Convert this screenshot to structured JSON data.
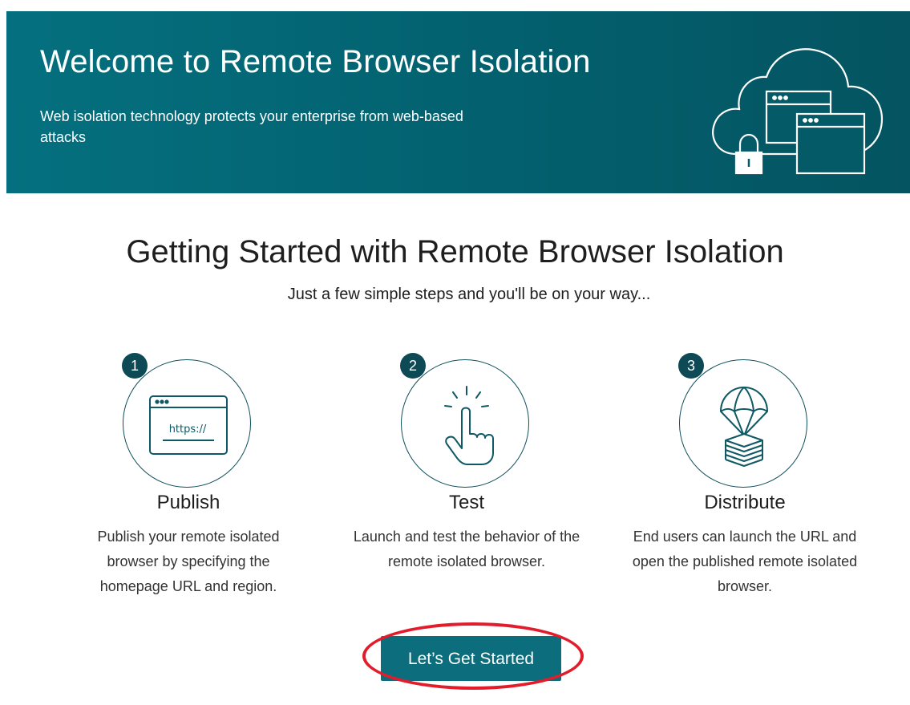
{
  "banner": {
    "title": "Welcome to Remote Browser Isolation",
    "subtitle": "Web isolation technology protects your enterprise from web-based attacks",
    "illustration_icon": "cloud-browser-lock-icon"
  },
  "main": {
    "title": "Getting Started with Remote Browser Isolation",
    "subtitle": "Just a few simple steps and you'll be on your way..."
  },
  "steps": [
    {
      "number": "1",
      "icon": "browser-url-icon",
      "url_text": "https://",
      "title": "Publish",
      "description": "Publish your remote isolated browser by specifying the homepage URL and region."
    },
    {
      "number": "2",
      "icon": "tap-hand-icon",
      "title": "Test",
      "description": "Launch and test the behavior of the remote isolated browser."
    },
    {
      "number": "3",
      "icon": "parachute-package-icon",
      "title": "Distribute",
      "description": "End users can launch the URL and open the published remote isolated browser."
    }
  ],
  "cta": {
    "label": "Let’s Get Started"
  },
  "colors": {
    "banner": "#03606e",
    "accent": "#0c6e7c",
    "badge": "#0d4a55",
    "highlight": "#e31c2c"
  }
}
